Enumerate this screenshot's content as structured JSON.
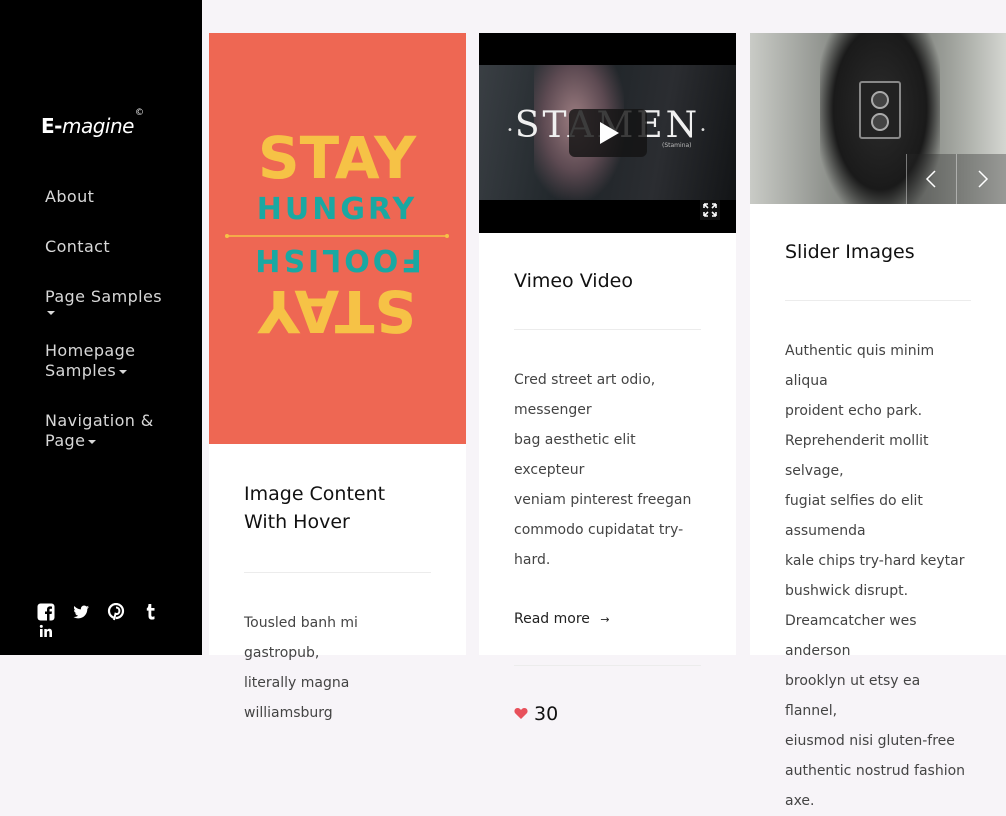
{
  "sidebar": {
    "logo": {
      "brand_e": "E-",
      "brand_rest": "magine",
      "mark": "©"
    },
    "nav": [
      {
        "label": "About"
      },
      {
        "label": "Contact"
      },
      {
        "label": "Page Samples"
      },
      {
        "label_line1": "Homepage",
        "label_line2": "Samples"
      },
      {
        "label_line1": "Navigation &",
        "label_line2": "Page"
      }
    ],
    "social_icons": [
      "facebook-icon",
      "twitter-icon",
      "pinterest-icon",
      "tumblr-icon",
      "linkedin-icon"
    ]
  },
  "cards": [
    {
      "poster_text": {
        "line1": "STAY",
        "line2": "HUNGRY",
        "line3": "FOOLISH",
        "line4": "STAY"
      },
      "title": "Image Content With Hover",
      "excerpt_line1": "Tousled banh mi gastropub,",
      "excerpt_line2": "literally magna williamsburg"
    },
    {
      "video": {
        "title": "STAMEN",
        "subtitle": "(Stamina)"
      },
      "title": "Vimeo Video",
      "excerpt": [
        "Cred street art odio, messenger",
        "bag aesthetic elit excepteur",
        "veniam pinterest freegan",
        "commodo cupidatat try-hard."
      ],
      "read_more": "Read more",
      "likes": "30"
    },
    {
      "title": "Slider Images",
      "excerpt": [
        "Authentic quis minim aliqua",
        "proident echo park.",
        "Reprehenderit mollit selvage,",
        "fugiat selfies do elit assumenda",
        "kale chips try-hard keytar",
        "bushwick disrupt.",
        "Dreamcatcher wes anderson",
        "brooklyn ut etsy ea flannel,",
        "eiusmod nisi gluten-free",
        "authentic nostrud fashion axe."
      ]
    }
  ],
  "colors": {
    "poster_bg": "#ee6753",
    "poster_yellow": "#f6c246",
    "poster_teal": "#1aa8a2",
    "heart": "#e8505b"
  }
}
